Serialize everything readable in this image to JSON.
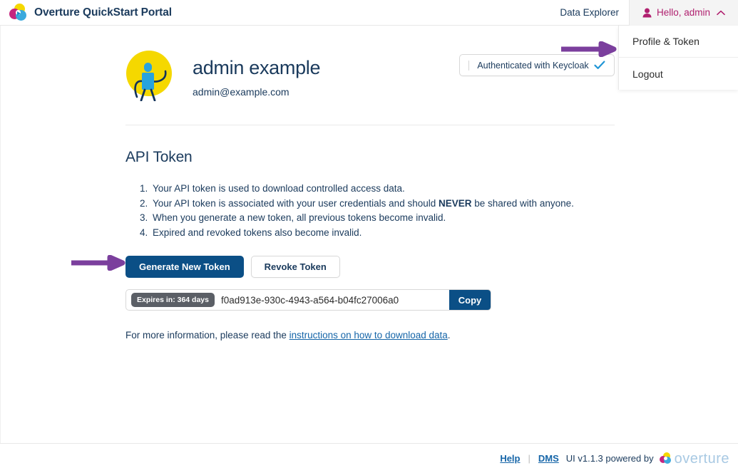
{
  "header": {
    "brand_title": "Overture QuickStart Portal",
    "brand_logo_icon": "overture-logo-icon",
    "nav": {
      "data_explorer": "Data Explorer"
    },
    "user_menu": {
      "label": "Hello, admin",
      "user_icon": "user-icon",
      "chevron_icon": "chevron-up-icon",
      "accent_color": "#b0206f"
    }
  },
  "dropdown": {
    "items": [
      {
        "label": "Profile & Token"
      },
      {
        "label": "Logout"
      }
    ]
  },
  "profile": {
    "avatar_icon": "user-avatar-illustration",
    "name": "admin example",
    "email": "admin@example.com",
    "auth_badge": {
      "label": "Authenticated with Keycloak",
      "check_icon": "check-icon",
      "check_color": "#2196d6"
    }
  },
  "api_token": {
    "title": "API Token",
    "notes": [
      {
        "pre": "Your API token is used to download controlled access data.",
        "bold": "",
        "post": ""
      },
      {
        "pre": "Your API token is associated with your user credentials and should ",
        "bold": "NEVER",
        "post": " be shared with anyone."
      },
      {
        "pre": "When you generate a new token, all previous tokens become invalid.",
        "bold": "",
        "post": ""
      },
      {
        "pre": "Expired and revoked tokens also become invalid.",
        "bold": "",
        "post": ""
      }
    ],
    "generate_button": "Generate New Token",
    "revoke_button": "Revoke Token",
    "expires_badge": "Expires in: 364 days",
    "token_value": "f0ad913e-930c-4943-a564-b04fc27006a0",
    "copy_button": "Copy",
    "more_info_prefix": "For more information, please read the ",
    "more_info_link": "instructions on how to download data",
    "more_info_suffix": "."
  },
  "annotations": {
    "arrow_color": "#7b3f9d",
    "arrow_to_dropdown": "arrow-right-icon",
    "arrow_to_generate_button": "arrow-right-icon"
  },
  "footer": {
    "help_label": "Help",
    "separator": "|",
    "dms_label": "DMS",
    "version_text": "UI v1.1.3 powered by",
    "brand_word": "overture",
    "brand_logo_icon": "overture-logo-icon"
  },
  "theme": {
    "primary_blue": "#0b4f86",
    "text_navy": "#1a3a5c",
    "link_blue": "#1565a8",
    "magenta": "#b0206f",
    "pill_gray": "#5b5f66"
  }
}
